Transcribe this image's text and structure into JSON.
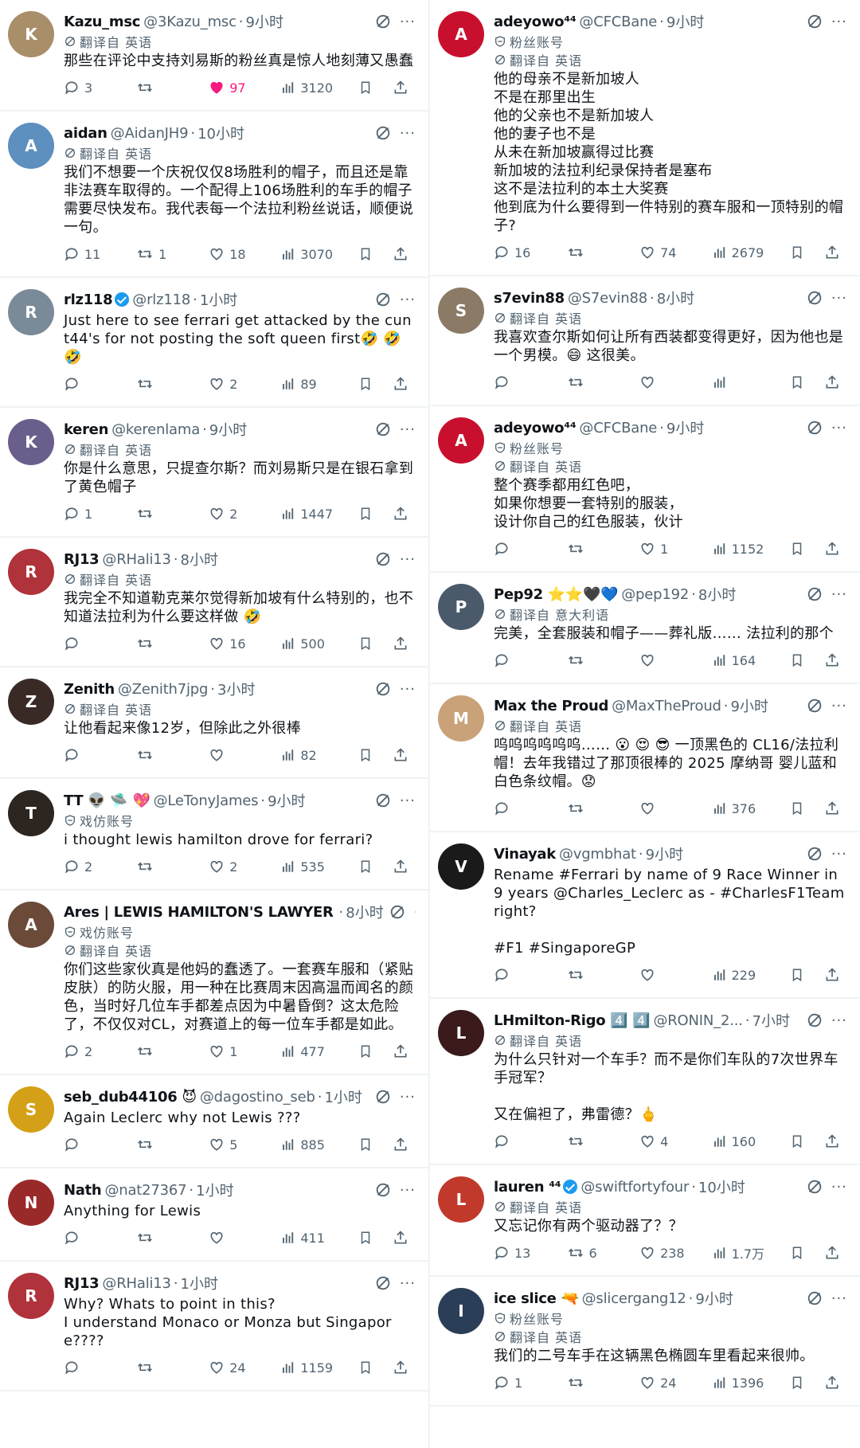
{
  "left": [
    {
      "name": "Kazu_msc",
      "handle": "@3Kazu_msc",
      "time": "9小时",
      "badges": "",
      "labels": [
        "翻译自 英语"
      ],
      "text": "那些在评论中支持刘易斯的粉丝真是惊人地刻薄又愚蠢",
      "reply": "3",
      "retweet": "",
      "like": "97",
      "liked": true,
      "views": "3120",
      "avatar_color": "#a88f6a",
      "avatar_initial": "K"
    },
    {
      "name": "aidan",
      "handle": "@AidanJH9",
      "time": "10小时",
      "badges": "",
      "labels": [
        "翻译自 英语"
      ],
      "text": "我们不想要一个庆祝仅仅8场胜利的帽子，而且还是靠非法赛车取得的。一个配得上106场胜利的车手的帽子需要尽快发布。我代表每一个法拉利粉丝说话，顺便说一句。",
      "reply": "11",
      "retweet": "1",
      "like": "18",
      "liked": false,
      "views": "3070",
      "avatar_color": "#5d8fbf",
      "avatar_initial": "A"
    },
    {
      "name": "rlz118",
      "handle": "@rlz118",
      "time": "1小时",
      "badges": "verified",
      "labels": [],
      "text": "Just here to see ferrari get attacked by the cunt44's for not posting the soft queen first🤣 🤣 🤣",
      "reply": "",
      "retweet": "",
      "like": "2",
      "liked": false,
      "views": "89",
      "avatar_color": "#7a8a99",
      "avatar_initial": "R"
    },
    {
      "name": "keren",
      "handle": "@kerenlama",
      "time": "9小时",
      "badges": "",
      "labels": [
        "翻译自 英语"
      ],
      "text": "你是什么意思，只提查尔斯？而刘易斯只是在银石拿到了黄色帽子",
      "reply": "1",
      "retweet": "",
      "like": "2",
      "liked": false,
      "views": "1447",
      "avatar_color": "#6a5f8c",
      "avatar_initial": "K"
    },
    {
      "name": "RJ13",
      "handle": "@RHali13",
      "time": "8小时",
      "badges": "",
      "labels": [
        "翻译自 英语"
      ],
      "text": "我完全不知道勒克莱尔觉得新加坡有什么特别的，也不知道法拉利为什么要这样做 🤣",
      "reply": "",
      "retweet": "",
      "like": "16",
      "liked": false,
      "views": "500",
      "avatar_color": "#b0323a",
      "avatar_initial": "R"
    },
    {
      "name": "Zenith",
      "handle": "@Zenith7jpg",
      "time": "3小时",
      "badges": "",
      "labels": [
        "翻译自 英语"
      ],
      "text": "让他看起来像12岁，但除此之外很棒",
      "reply": "",
      "retweet": "",
      "like": "",
      "liked": false,
      "views": "82",
      "avatar_color": "#3a2a26",
      "avatar_initial": "Z"
    },
    {
      "name": "TT 👽 🛸 💖",
      "handle": "@LeTonyJames",
      "time": "9小时",
      "badges": "",
      "labels": [
        "戏仿账号"
      ],
      "text": "i thought lewis hamilton drove for ferrari?",
      "reply": "2",
      "retweet": "",
      "like": "2",
      "liked": false,
      "views": "535",
      "avatar_color": "#2c2520",
      "avatar_initial": "T"
    },
    {
      "name": "Ares | LEWIS HAMILTON'S LAWYER",
      "handle": "",
      "time": "8小时",
      "badges": "",
      "labels": [
        "戏仿账号",
        "翻译自 英语"
      ],
      "text": "你们这些家伙真是他妈的蠢透了。一套赛车服和（紧贴皮肤）的防火服，用一种在比赛周末因高温而闻名的颜色，当时好几位车手都差点因为中暑昏倒？这太危险了，不仅仅对CL，对赛道上的每一位车手都是如此。",
      "reply": "2",
      "retweet": "",
      "like": "1",
      "liked": false,
      "views": "477",
      "avatar_color": "#6b4a3a",
      "avatar_initial": "A"
    },
    {
      "name": "seb_dub44106 😈",
      "handle": "@dagostino_seb",
      "time": "1小时",
      "badges": "",
      "labels": [],
      "text": "Again Leclerc why not Lewis ???",
      "reply": "",
      "retweet": "",
      "like": "5",
      "liked": false,
      "views": "885",
      "avatar_color": "#d4a017",
      "avatar_initial": "S"
    },
    {
      "name": "Nath",
      "handle": "@nat27367",
      "time": "1小时",
      "badges": "",
      "labels": [],
      "text": "Anything for Lewis",
      "reply": "",
      "retweet": "",
      "like": "",
      "liked": false,
      "views": "411",
      "avatar_color": "#9a2a2a",
      "avatar_initial": "N"
    },
    {
      "name": "RJ13",
      "handle": "@RHali13",
      "time": "1小时",
      "badges": "",
      "labels": [],
      "text": "Why? Whats to point in this?\nI understand Monaco or Monza but Singapore????",
      "reply": "",
      "retweet": "",
      "like": "24",
      "liked": false,
      "views": "1159",
      "avatar_color": "#b0323a",
      "avatar_initial": "R"
    }
  ],
  "right": [
    {
      "name": "adeyowo⁴⁴",
      "handle": "@CFCBane",
      "time": "9小时",
      "badges": "",
      "labels": [
        "粉丝账号",
        "翻译自 英语"
      ],
      "text": "他的母亲不是新加坡人\n不是在那里出生\n他的父亲也不是新加坡人\n他的妻子也不是\n从未在新加坡赢得过比赛\n新加坡的法拉利纪录保持者是塞布\n这不是法拉利的本土大奖赛\n他到底为什么要得到一件特别的赛车服和一顶特别的帽子?",
      "reply": "16",
      "retweet": "",
      "like": "74",
      "liked": false,
      "views": "2679",
      "avatar_color": "#c8102e",
      "avatar_initial": "A"
    },
    {
      "name": "s7evin88",
      "handle": "@S7evin88",
      "time": "8小时",
      "badges": "",
      "labels": [
        "翻译自 英语"
      ],
      "text": "我喜欢查尔斯如何让所有西装都变得更好，因为他也是一个男模。😄 这很美。",
      "reply": "",
      "retweet": "",
      "like": "",
      "liked": false,
      "views": "",
      "avatar_color": "#8a7a66",
      "avatar_initial": "S"
    },
    {
      "name": "adeyowo⁴⁴",
      "handle": "@CFCBane",
      "time": "9小时",
      "badges": "",
      "labels": [
        "粉丝账号",
        "翻译自 英语"
      ],
      "text": "整个赛季都用红色吧，\n如果你想要一套特别的服装，\n设计你自己的红色服装，伙计",
      "reply": "",
      "retweet": "",
      "like": "1",
      "liked": false,
      "views": "1152",
      "avatar_color": "#c8102e",
      "avatar_initial": "A"
    },
    {
      "name": "Pep92 ⭐⭐🖤💙",
      "handle": "@pep192",
      "time": "8小时",
      "badges": "",
      "labels": [
        "翻译自 意大利语"
      ],
      "text": "完美，全套服装和帽子——葬礼版…… 法拉利的那个",
      "reply": "",
      "retweet": "",
      "like": "",
      "liked": false,
      "views": "164",
      "avatar_color": "#4a5a6a",
      "avatar_initial": "P"
    },
    {
      "name": "Max the Proud",
      "handle": "@MaxTheProud",
      "time": "9小时",
      "badges": "",
      "labels": [
        "翻译自 英语"
      ],
      "text": "呜呜呜呜呜呜…… 😮 😍 😎 一顶黑色的 CL16/法拉利 帽！去年我错过了那顶很棒的 2025 摩纳哥 婴儿蓝和白色条纹帽。😟",
      "reply": "",
      "retweet": "",
      "like": "",
      "liked": false,
      "views": "376",
      "avatar_color": "#c9a27a",
      "avatar_initial": "M"
    },
    {
      "name": "Vinayak",
      "handle": "@vgmbhat",
      "time": "9小时",
      "badges": "",
      "labels": [],
      "text": "Rename #Ferrari by name of  9 Race Winner in 9 years @Charles_Leclerc  as - #CharlesF1Team right?\n\n#F1 #SingaporeGP",
      "reply": "",
      "retweet": "",
      "like": "",
      "liked": false,
      "views": "229",
      "avatar_color": "#1a1a1a",
      "avatar_initial": "V"
    },
    {
      "name": "LHmilton-Rigo 4️⃣ 4️⃣",
      "handle": "@RONIN_2...",
      "time": "7小时",
      "badges": "",
      "labels": [
        "翻译自 英语"
      ],
      "text": "为什么只针对一个车手？而不是你们车队的7次世界车手冠军？\n\n又在偏袒了，弗雷德？🖕",
      "reply": "",
      "retweet": "",
      "like": "4",
      "liked": false,
      "views": "160",
      "avatar_color": "#3a1a1a",
      "avatar_initial": "L"
    },
    {
      "name": "lauren ⁴⁴",
      "handle": "@swiftfortyfour",
      "time": "10小时",
      "badges": "verified",
      "labels": [
        "翻译自 英语"
      ],
      "text": "又忘记你有两个驱动器了？？",
      "reply": "13",
      "retweet": "6",
      "like": "238",
      "liked": false,
      "views": "1.7万",
      "avatar_color": "#c0392b",
      "avatar_initial": "L"
    },
    {
      "name": "ice slice 🔫",
      "handle": "@slicergang12",
      "time": "9小时",
      "badges": "",
      "labels": [
        "粉丝账号",
        "翻译自 英语"
      ],
      "text": "我们的二号车手在这辆黑色椭圆车里看起来很帅。",
      "reply": "1",
      "retweet": "",
      "like": "24",
      "liked": false,
      "views": "1396",
      "avatar_color": "#2b3e57",
      "avatar_initial": "I"
    }
  ]
}
